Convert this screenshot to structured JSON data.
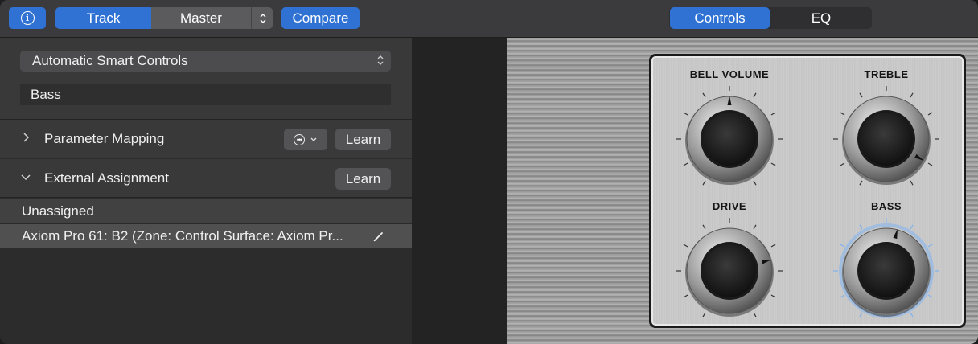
{
  "toolbar": {
    "info_icon": "info-icon",
    "track_label": "Track",
    "master_label": "Master",
    "compare_label": "Compare",
    "view_tabs": [
      {
        "label": "Controls",
        "selected": true
      },
      {
        "label": "EQ",
        "selected": false
      }
    ]
  },
  "inspector": {
    "smart_controls_select": "Automatic Smart Controls",
    "name_value": "Bass",
    "parameter_mapping": {
      "label": "Parameter Mapping",
      "expanded": false,
      "learn_label": "Learn"
    },
    "external_assignment": {
      "label": "External Assignment",
      "expanded": true,
      "learn_label": "Learn"
    },
    "assignments": [
      {
        "label": "Unassigned",
        "selected": false
      },
      {
        "label": "Axiom Pro 61: B2 (Zone: Control Surface: Axiom Pr...",
        "selected": true
      }
    ]
  },
  "knobs": [
    {
      "label": "BELL VOLUME",
      "value": 0.5,
      "highlighted": false
    },
    {
      "label": "TREBLE",
      "value": 0.9,
      "highlighted": false
    },
    {
      "label": "DRIVE",
      "value": 0.75,
      "highlighted": false
    },
    {
      "label": "BASS",
      "value": 0.55,
      "highlighted": true
    }
  ],
  "colors": {
    "accent": "#2f72d4",
    "highlight_glow": "#7fb2f0"
  }
}
